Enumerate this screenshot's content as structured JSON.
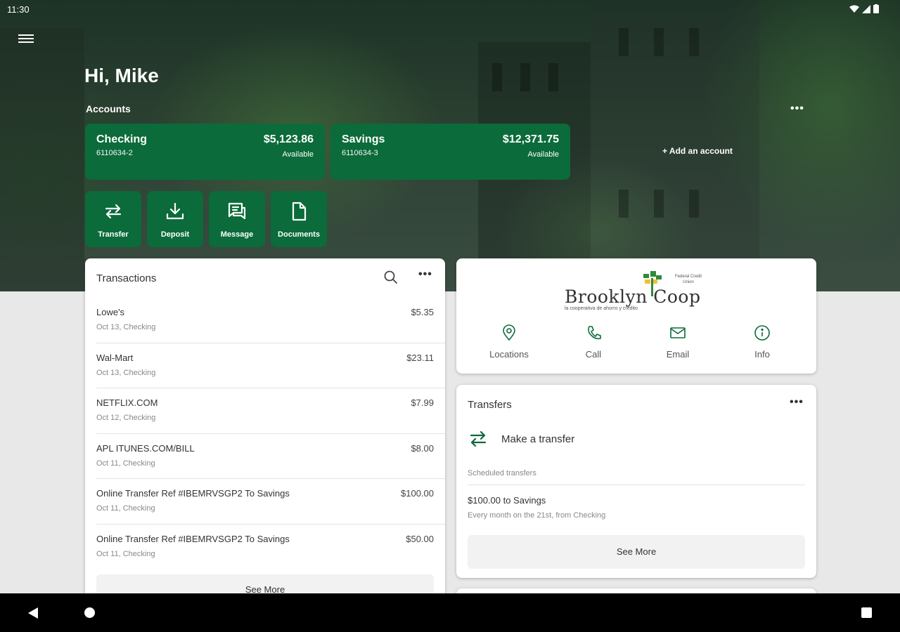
{
  "status_bar": {
    "time": "11:30"
  },
  "greeting": "Hi, Mike",
  "accounts": {
    "label": "Accounts",
    "more": "•••",
    "items": [
      {
        "name": "Checking",
        "number": "6110634-2",
        "balance": "$5,123.86",
        "available_label": "Available"
      },
      {
        "name": "Savings",
        "number": "6110634-3",
        "balance": "$12,371.75",
        "available_label": "Available"
      }
    ],
    "add_label": "+ Add an account"
  },
  "quick_actions": [
    {
      "label": "Transfer",
      "icon": "transfer-icon"
    },
    {
      "label": "Deposit",
      "icon": "download-icon"
    },
    {
      "label": "Message",
      "icon": "message-icon"
    },
    {
      "label": "Documents",
      "icon": "document-icon"
    }
  ],
  "transactions": {
    "title": "Transactions",
    "more": "•••",
    "items": [
      {
        "name": "Lowe's",
        "meta": "Oct 13, Checking",
        "amount": "$5.35"
      },
      {
        "name": "Wal-Mart",
        "meta": "Oct 13, Checking",
        "amount": "$23.11"
      },
      {
        "name": "NETFLIX.COM",
        "meta": "Oct 12, Checking",
        "amount": "$7.99"
      },
      {
        "name": "APL ITUNES.COM/BILL",
        "meta": "Oct 11, Checking",
        "amount": "$8.00"
      },
      {
        "name": "Online Transfer Ref #IBEMRVSGP2 To Savings",
        "meta": "Oct 11, Checking",
        "amount": "$100.00"
      },
      {
        "name": "Online Transfer Ref #IBEMRVSGP2 To Savings",
        "meta": "Oct 11, Checking",
        "amount": "$50.00"
      }
    ],
    "see_more": "See More"
  },
  "credit_union": {
    "logo_text": "Brooklyn Coop",
    "logo_sub": "Federal Credit Union",
    "logo_tagline": "la cooperativa de ahorro y crédito",
    "actions": [
      {
        "label": "Locations",
        "icon": "location-pin-icon"
      },
      {
        "label": "Call",
        "icon": "phone-icon"
      },
      {
        "label": "Email",
        "icon": "email-icon"
      },
      {
        "label": "Info",
        "icon": "info-icon"
      }
    ]
  },
  "transfers": {
    "title": "Transfers",
    "more": "•••",
    "make_transfer": "Make a transfer",
    "scheduled_label": "Scheduled transfers",
    "scheduled_item": {
      "title": "$100.00 to Savings",
      "detail": "Every month on the 21st, from Checking"
    },
    "see_more": "See More"
  },
  "colors": {
    "brand": "#0b6b3a",
    "background": "#e8e8e8",
    "logo_green": "#2e8b3a",
    "logo_yellow": "#f2c230"
  }
}
